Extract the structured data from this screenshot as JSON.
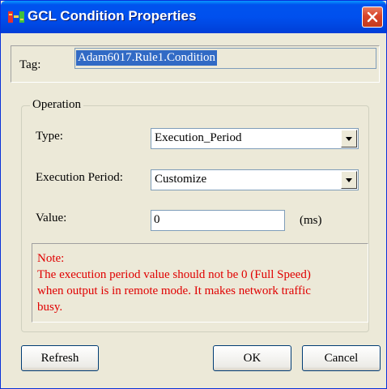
{
  "window": {
    "title": "GCL Condition Properties",
    "title_color": "#ffffff",
    "titlebar_color": "#0050ee",
    "icons": {
      "app": "gcl-app-icon",
      "close": "close-icon"
    }
  },
  "tag": {
    "label": "Tag:",
    "value": "Adam6017.Rule1.Condition"
  },
  "operation": {
    "group_label": "Operation",
    "type_label": "Type:",
    "type_value": "Execution_Period",
    "period_label": "Execution Period:",
    "period_value": "Customize",
    "value_label": "Value:",
    "value": "0",
    "unit": "(ms)",
    "dropdown_icon": "chevron-down-icon"
  },
  "note": {
    "heading": "Note:",
    "lines": [
      "The execution period value should not be 0 (Full Speed)",
      "when output is in remote mode. It makes network traffic",
      "busy."
    ],
    "color": "#e00000"
  },
  "buttons": {
    "refresh": "Refresh",
    "ok": "OK",
    "cancel": "Cancel"
  }
}
